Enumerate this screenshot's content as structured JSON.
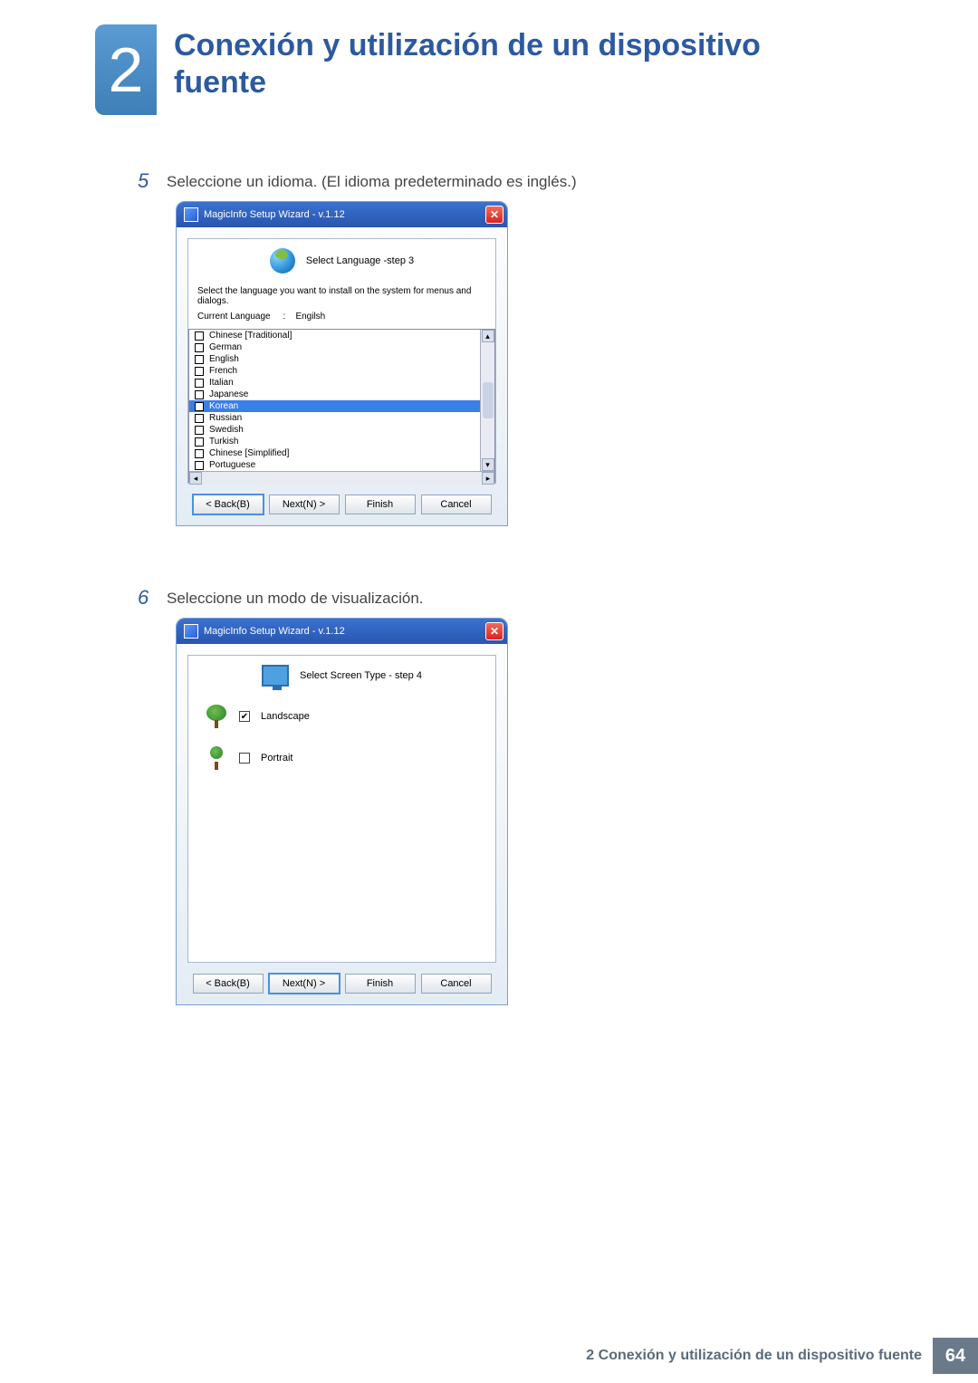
{
  "chapter": {
    "number": "2",
    "title": "Conexión y utilización de un dispositivo fuente"
  },
  "step5": {
    "num": "5",
    "text": "Seleccione un idioma. (El idioma predeterminado es inglés.)"
  },
  "step6": {
    "num": "6",
    "text": "Seleccione un modo de visualización."
  },
  "wizard_title": "MagicInfo Setup Wizard - v.1.12",
  "lang_panel": {
    "title": "Select Language -step 3",
    "desc": "Select the language you want to install on the system for menus and dialogs.",
    "current_label": "Current Language",
    "current_sep": ":",
    "current_value": "Engilsh",
    "items": [
      "Chinese [Traditional]",
      "German",
      "English",
      "French",
      "Italian",
      "Japanese",
      "Korean",
      "Russian",
      "Swedish",
      "Turkish",
      "Chinese [Simplified]",
      "Portuguese"
    ],
    "selected_index": 6
  },
  "screen_panel": {
    "title": "Select Screen Type - step 4",
    "options": [
      {
        "label": "Landscape",
        "checked": true
      },
      {
        "label": "Portrait",
        "checked": false
      }
    ]
  },
  "buttons": {
    "back": "< Back(B)",
    "next": "Next(N) >",
    "finish": "Finish",
    "cancel": "Cancel"
  },
  "footer": {
    "text": "2 Conexión y utilización de un dispositivo fuente",
    "page": "64"
  },
  "icons": {
    "close_glyph": "✕",
    "check_glyph": "✔",
    "up": "▴",
    "down": "▾",
    "left": "◂",
    "right": "▸"
  }
}
